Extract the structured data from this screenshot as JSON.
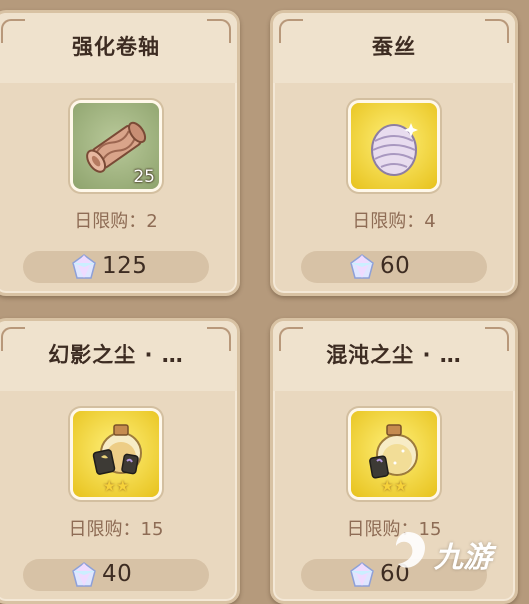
{
  "shop": {
    "items": [
      {
        "name": "强化卷轴",
        "quantity": "25",
        "limit": "日限购：2",
        "price": "125",
        "stars": ""
      },
      {
        "name": "蚕丝",
        "quantity": "",
        "limit": "日限购：4",
        "price": "60",
        "stars": ""
      },
      {
        "name": "幻影之尘 · …",
        "quantity": "",
        "limit": "日限购：15",
        "price": "40",
        "stars": "★★"
      },
      {
        "name": "混沌之尘 · …",
        "quantity": "",
        "limit": "日限购：15",
        "price": "60",
        "stars": "★★"
      }
    ],
    "icons": [
      "scroll-icon",
      "silk-cocoon-icon",
      "phantom-dust-bottle-icon",
      "chaos-dust-bottle-icon"
    ],
    "currency_icon": "crystal-gem-icon"
  },
  "watermark": {
    "text": "九游"
  },
  "colors": {
    "background": "#b59a7c",
    "card": "#e9d8bf",
    "title_text": "#3d2c22",
    "limit_text": "#8e6c55",
    "price_bar": "#d7c2a6",
    "frame_green": "#9fb27c",
    "frame_gold": "#f2d53a"
  }
}
